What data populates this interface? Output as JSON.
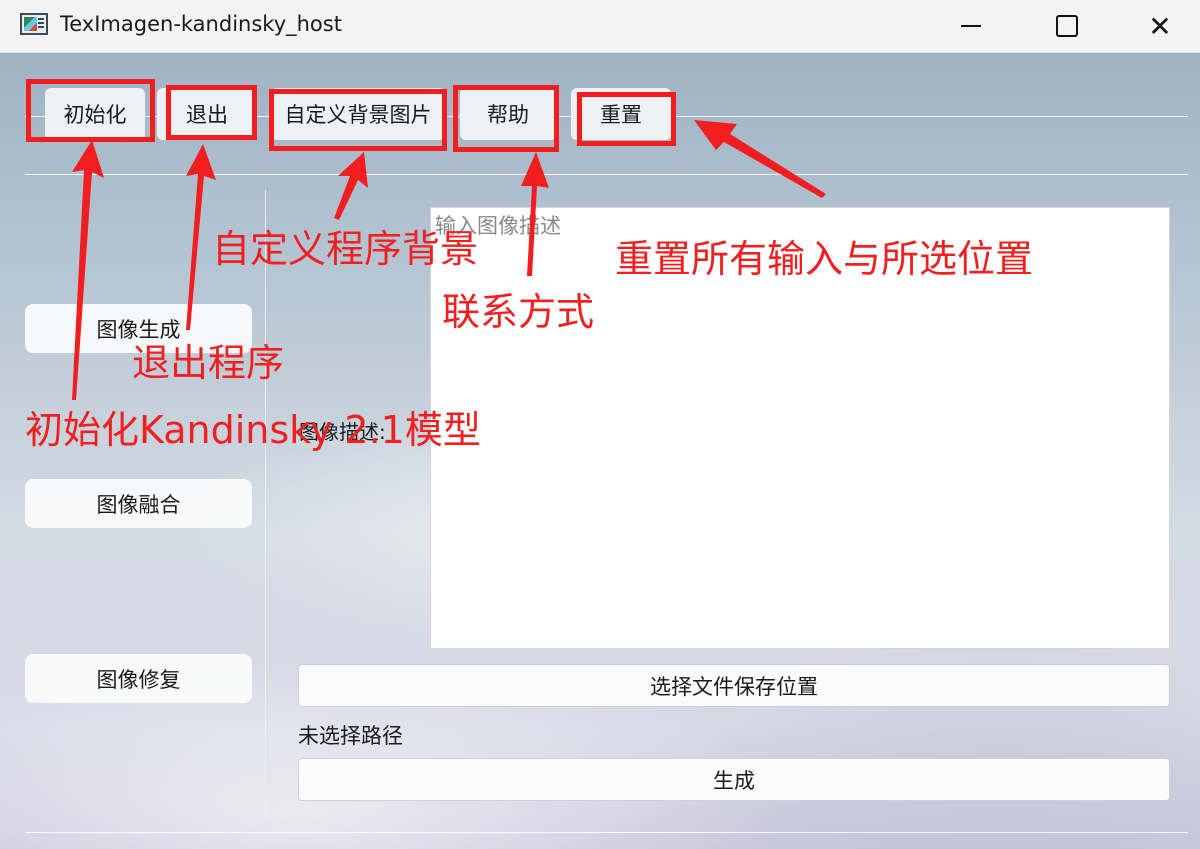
{
  "window": {
    "title": "TexImagen-kandinsky_host",
    "minimize_icon": "minimize-icon",
    "maximize_icon": "maximize-icon",
    "close_icon": "close-icon",
    "close_glyph": "✕"
  },
  "toolbar": {
    "init_label": "初始化",
    "exit_label": "退出",
    "bg_label": "自定义背景图片",
    "help_label": "帮助",
    "reset_label": "重置"
  },
  "sidebar": {
    "items": [
      {
        "label": "图像生成"
      },
      {
        "label": "图像融合"
      },
      {
        "label": "图像修复"
      }
    ]
  },
  "main": {
    "description_placeholder": "输入图像描述",
    "description_label": "图像描述:",
    "save_location_button": "选择文件保存位置",
    "path_status": "未选择路径",
    "generate_button": "生成"
  },
  "annotations": {
    "color": "#f01e1e",
    "init_note": "初始化Kandinsky 2.1模型",
    "exit_note": "退出程序",
    "bg_note": "自定义程序背景",
    "help_note": "联系方式",
    "reset_note": "重置所有输入与所选位置"
  }
}
